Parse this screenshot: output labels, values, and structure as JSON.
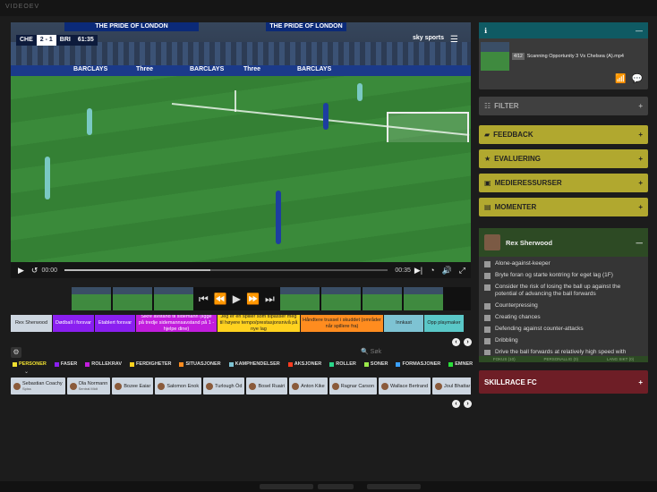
{
  "topstrip": {
    "title": "VIDEOEV"
  },
  "video": {
    "banners": [
      "THE PRIDE OF LONDON",
      "THE PRIDE OF LONDON"
    ],
    "adboards": [
      "BARCLAYS",
      "Three",
      "BARCLAYS",
      "Three",
      "BARCLAYS"
    ],
    "score": {
      "home": "CHE",
      "result": "2 - 1",
      "away": "BRI",
      "clock": "61:35"
    },
    "broadcaster": "sky sports"
  },
  "player_bar": {
    "time_current": "00:00",
    "time_total": "00:35",
    "progress": 0.45
  },
  "tags": [
    {
      "label": "Rex Sherwood",
      "color": "#cdd6e0",
      "text": "#222"
    },
    {
      "label": "Dødball i forsvar",
      "color": "#8a1ff0",
      "text": "#fff"
    },
    {
      "label": "Etablert forsvar",
      "color": "#8a1ff0",
      "text": "#fff"
    },
    {
      "label": "Sikre avstand til sidemann (ligge på tredje sidemannsavstand på 1 - hjelpe dine)",
      "color": "#c21ddd",
      "text": "#fff"
    },
    {
      "label": "Jeg er en spiller som tilpasser meg til høyere tempo/prestasjonsnivå på nye lag",
      "color": "#ffd21f",
      "text": "#222"
    },
    {
      "label": "Håndtere trussel i skuddet (områder når spillere fra)",
      "color": "#ff8c1f",
      "text": "#222"
    },
    {
      "label": "Innkast",
      "color": "#7ec3d3",
      "text": "#222"
    },
    {
      "label": "Opp playmaker",
      "color": "#5ac8c8",
      "text": "#222"
    }
  ],
  "search": {
    "placeholder": "Søk"
  },
  "legend": [
    {
      "label": "PERSONER",
      "color": "#f0e030"
    },
    {
      "label": "FASER",
      "color": "#8a1ff0"
    },
    {
      "label": "ROLLEKRAV",
      "color": "#c21ddd"
    },
    {
      "label": "FERDIGHETER",
      "color": "#ffd21f"
    },
    {
      "label": "SITUASJONER",
      "color": "#ff8c1f"
    },
    {
      "label": "KAMPHENDELSER",
      "color": "#7ec3d3"
    },
    {
      "label": "AKSJONER",
      "color": "#ff3b1f"
    },
    {
      "label": "ROLLER",
      "color": "#2ad68a"
    },
    {
      "label": "SONER",
      "color": "#9be84a"
    },
    {
      "label": "FORMASJONER",
      "color": "#3aa0ff"
    },
    {
      "label": "EMNER",
      "color": "#2adf3a"
    }
  ],
  "people": [
    {
      "name": "Sebastian Coachy",
      "role": "Spiss"
    },
    {
      "name": "Ola Normann",
      "role": "Sentral Midt"
    },
    {
      "name": "Bozee Eaiar",
      "role": ""
    },
    {
      "name": "Salomon Enok",
      "role": ""
    },
    {
      "name": "Turlough Öd",
      "role": ""
    },
    {
      "name": "Bosel Ruairi",
      "role": ""
    },
    {
      "name": "Anton Kike",
      "role": ""
    },
    {
      "name": "Ragnar Carson",
      "role": ""
    },
    {
      "name": "Wallace Bertrand",
      "role": ""
    },
    {
      "name": "Joul Bhattar",
      "role": ""
    }
  ],
  "panel": {
    "media": {
      "index": "4/12",
      "title": "Scanning Opportunity 3 Vs Chelsea (A).mp4"
    },
    "sections": [
      {
        "label": "FILTER",
        "style": "grey"
      },
      {
        "label": "FEEDBACK",
        "style": "yellow"
      },
      {
        "label": "EVALUERING",
        "style": "yellow"
      },
      {
        "label": "MEDIERESSURSER",
        "style": "yellow"
      },
      {
        "label": "MOMENTER",
        "style": "yellow"
      }
    ],
    "player": {
      "name": "Rex Sherwood"
    },
    "checklist": [
      "Alone-against-keeper",
      "Bryte foran og starte kontring for eget lag (1F)",
      "Consider the risk of losing the ball up against the potential of advancing the ball forwards",
      "Counterpressing",
      "Creating chances",
      "Defending against counter-attacks",
      "Dribbling",
      "Drive the ball forwards at relatively high speed with"
    ],
    "footer": [
      "FOKUS (10)",
      "PERSONALLIG (0)",
      "LANG SIKT (0)"
    ],
    "skill": {
      "label": "SKILLRACE FC"
    }
  }
}
